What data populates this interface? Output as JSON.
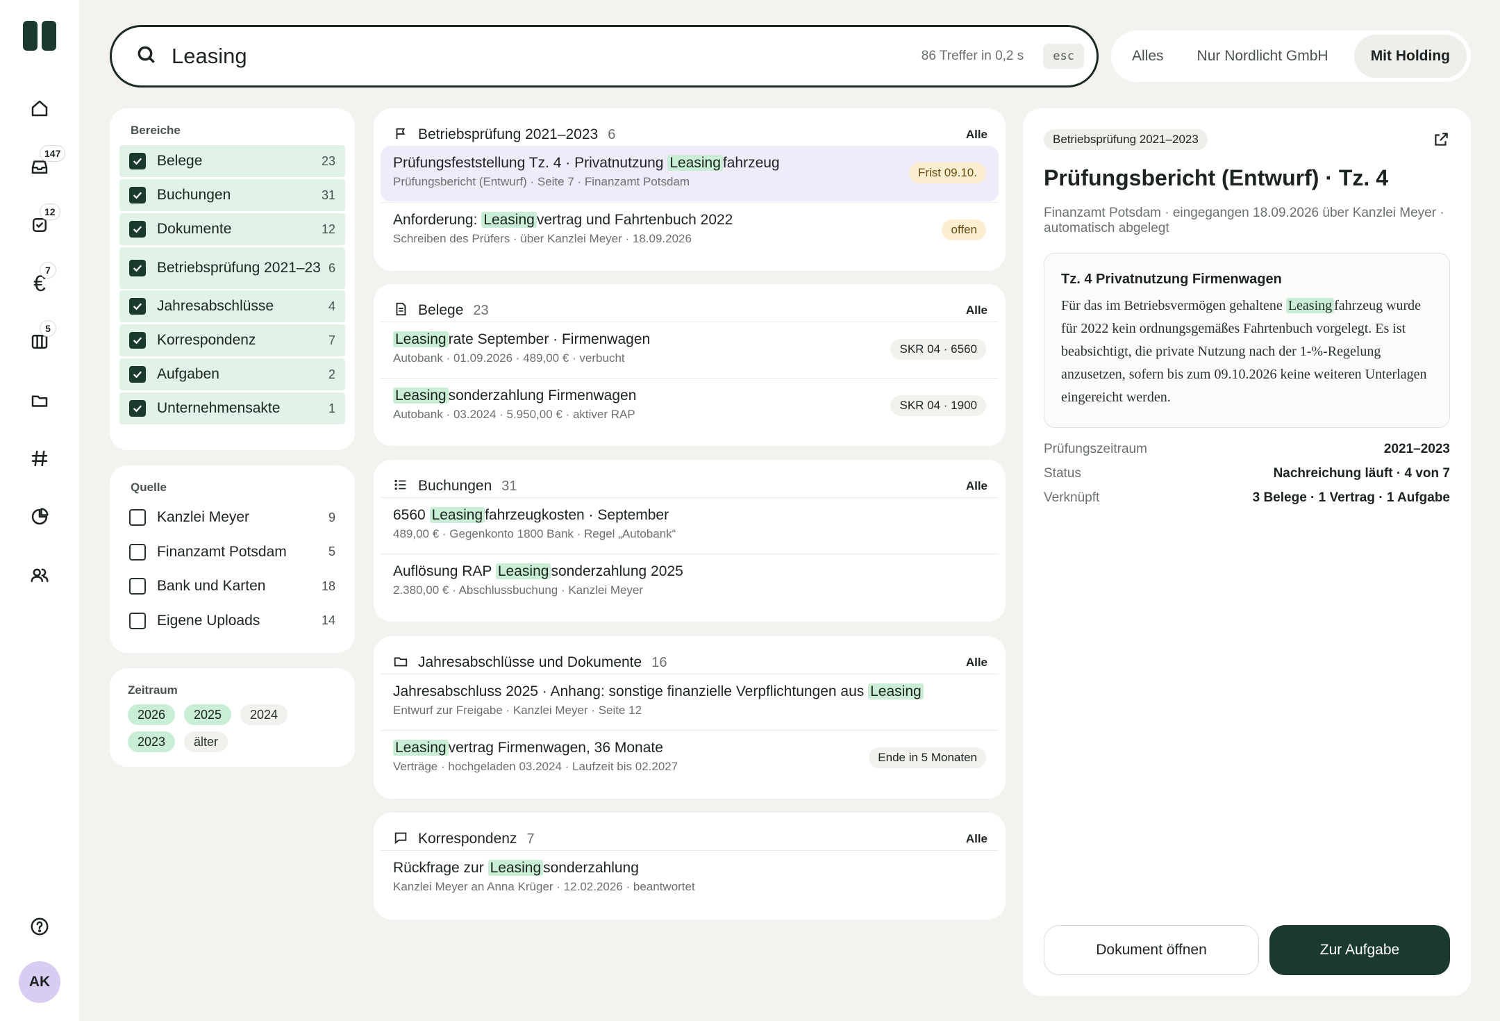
{
  "sidebar": {
    "badges": {
      "inbox": "147",
      "tasks": "12",
      "finance": "7",
      "columns": "5"
    },
    "avatar_initials": "AK"
  },
  "search": {
    "query": "Leasing",
    "meta": "86 Treffer in 0,2 s",
    "esc_label": "esc"
  },
  "scope": {
    "tabs": [
      "Alles",
      "Nur Nordlicht GmbH",
      "Mit Holding"
    ],
    "active": "Mit Holding"
  },
  "filters": {
    "areas_title": "Bereiche",
    "areas": [
      {
        "label": "Belege",
        "count": "23",
        "checked": true
      },
      {
        "label": "Buchungen",
        "count": "31",
        "checked": true
      },
      {
        "label": "Dokumente",
        "count": "12",
        "checked": true
      },
      {
        "label": "Betriebsprüfung 2021–23",
        "count": "6",
        "checked": true
      },
      {
        "label": "Jahresabschlüsse",
        "count": "4",
        "checked": true
      },
      {
        "label": "Korrespondenz",
        "count": "7",
        "checked": true
      },
      {
        "label": "Aufgaben",
        "count": "2",
        "checked": true
      },
      {
        "label": "Unternehmensakte",
        "count": "1",
        "checked": true
      }
    ],
    "source_title": "Quelle",
    "sources": [
      {
        "label": "Kanzlei Meyer",
        "count": "9",
        "checked": false
      },
      {
        "label": "Finanzamt Potsdam",
        "count": "5",
        "checked": false
      },
      {
        "label": "Bank und Karten",
        "count": "18",
        "checked": false
      },
      {
        "label": "Eigene Uploads",
        "count": "14",
        "checked": false
      }
    ],
    "period_title": "Zeitraum",
    "periods": [
      {
        "label": "2026",
        "on": true
      },
      {
        "label": "2025",
        "on": true
      },
      {
        "label": "2024",
        "on": false
      },
      {
        "label": "2023",
        "on": true
      },
      {
        "label": "älter",
        "on": false
      }
    ]
  },
  "results": {
    "all_label": "Alle",
    "groups": [
      {
        "title": "Betriebsprüfung 2021–2023",
        "count": "6",
        "icon": "flag-icon",
        "items": [
          {
            "pre": "Prüfungsfeststellung Tz. 4 · Privatnutzung ",
            "hl": "Leasing",
            "post": "fahrzeug",
            "sub": "Prüfungsbericht (Entwurf) · Seite 7 · Finanzamt Potsdam",
            "pill": "Frist 09.10.",
            "pill_type": "warn",
            "selected": true
          },
          {
            "pre": "Anforderung: ",
            "hl": "Leasing",
            "post": "vertrag und Fahrtenbuch 2022",
            "sub": "Schreiben des Prüfers · über Kanzlei Meyer · 18.09.2026",
            "pill": "offen",
            "pill_type": "warn"
          }
        ]
      },
      {
        "title": "Belege",
        "count": "23",
        "icon": "receipt-icon",
        "items": [
          {
            "pre": "",
            "hl": "Leasing",
            "post": "rate September · Firmenwagen",
            "sub": "Autobank · 01.09.2026 · 489,00 € · verbucht",
            "pill": "SKR 04 · 6560"
          },
          {
            "pre": "",
            "hl": "Leasing",
            "post": "sonderzahlung Firmenwagen",
            "sub": "Autobank · 03.2024 · 5.950,00 € · aktiver RAP",
            "pill": "SKR 04 · 1900"
          }
        ]
      },
      {
        "title": "Buchungen",
        "count": "31",
        "icon": "list-icon",
        "items": [
          {
            "pre": "6560 ",
            "hl": "Leasing",
            "post": "fahrzeugkosten · September",
            "sub": "489,00 € · Gegenkonto 1800 Bank · Regel „Autobank“"
          },
          {
            "pre": "Auflösung RAP ",
            "hl": "Leasing",
            "post": "sonderzahlung 2025",
            "sub": "2.380,00 € · Abschlussbuchung · Kanzlei Meyer"
          }
        ]
      },
      {
        "title": "Jahresabschlüsse und Dokumente",
        "count": "16",
        "icon": "folder-icon",
        "items": [
          {
            "pre": "Jahresabschluss 2025 · Anhang: sonstige finanzielle Verpflichtungen aus ",
            "hl": "Leasing",
            "post": "",
            "sub": "Entwurf zur Freigabe · Kanzlei Meyer · Seite 12"
          },
          {
            "pre": "",
            "hl": "Leasing",
            "post": "vertrag Firmenwagen, 36 Monate",
            "sub": "Verträge · hochgeladen 03.2024 · Laufzeit bis 02.2027",
            "pill": "Ende in 5 Monaten"
          }
        ]
      },
      {
        "title": "Korrespondenz",
        "count": "7",
        "icon": "chat-icon",
        "items": [
          {
            "pre": "Rückfrage zur ",
            "hl": "Leasing",
            "post": "sonderzahlung",
            "sub": "Kanzlei Meyer an Anna Krüger · 12.02.2026 · beantwortet"
          }
        ]
      }
    ]
  },
  "detail": {
    "tag": "Betriebsprüfung 2021–2023",
    "title": "Prüfungsbericht (Entwurf) · Tz. 4",
    "meta": "Finanzamt Potsdam · eingegangen 18.09.2026 über Kanzlei Meyer · automatisch abgelegt",
    "quote_title": "Tz. 4 Privatnutzung Firmenwagen",
    "quote_pre": "Für das im Betriebsvermögen gehaltene ",
    "quote_hl": "Leasing",
    "quote_post": "fahrzeug wurde für 2022 kein ordnungsgemäßes Fahrtenbuch vorgelegt. Es ist beabsichtigt, die private Nutzung nach der 1-%-Regelung anzusetzen, sofern bis zum 09.10.2026 keine weiteren Unterlagen eingereicht werden.",
    "facts": [
      {
        "key": "Prüfungszeitraum",
        "value": "2021–2023"
      },
      {
        "key": "Status",
        "value": "Nachreichung läuft · 4 von 7"
      },
      {
        "key": "Verknüpft",
        "value": "3 Belege · 1 Vertrag · 1 Aufgabe"
      }
    ],
    "open_label": "Dokument öffnen",
    "task_label": "Zur Aufgabe"
  }
}
